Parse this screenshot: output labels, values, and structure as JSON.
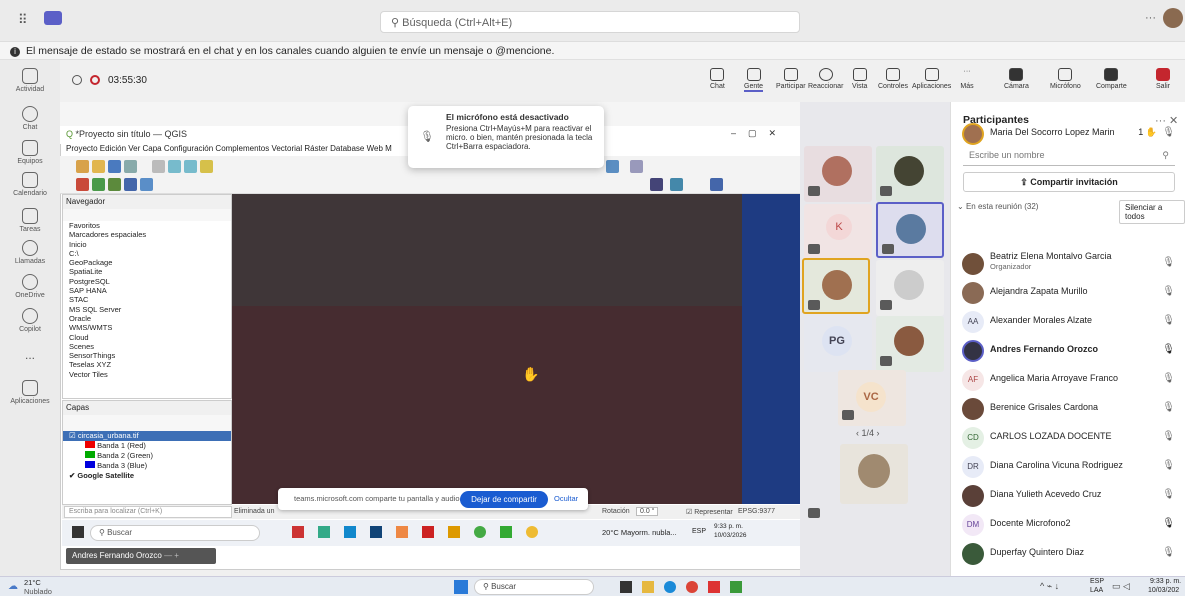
{
  "topbar": {
    "search_placeholder": "Búsqueda (Ctrl+Alt+E)",
    "more": "···"
  },
  "banner": {
    "text": "El mensaje de estado se mostrará en el chat y en los canales cuando alguien te envíe un mensaje o @mencione."
  },
  "rail": [
    {
      "label": "Actividad"
    },
    {
      "label": "Chat"
    },
    {
      "label": "Equipos"
    },
    {
      "label": "Calendario"
    },
    {
      "label": "Tareas"
    },
    {
      "label": "Llamadas"
    },
    {
      "label": "OneDrive"
    },
    {
      "label": "Copilot"
    },
    {
      "label": "..."
    },
    {
      "label": "Aplicaciones"
    }
  ],
  "meeting": {
    "timer": "03:55:30",
    "controls": [
      "Chat",
      "Gente",
      "Participar",
      "Reaccionar",
      "Vista",
      "Controles",
      "Aplicaciones",
      "Más",
      "Cámara",
      "Micrófono",
      "Comparte",
      "Salir"
    ]
  },
  "toast": {
    "title": "El micrófono está desactivado",
    "body": "Presiona Ctrl+Mayús+M para reactivar el micro. o bien, mantén presionada la tecla Ctrl+Barra espaciadora."
  },
  "qgis": {
    "title": "*Proyecto sin título — QGIS",
    "menu": "Proyecto  Edición  Ver  Capa  Configuración  Complementos  Vectorial  Ráster  Database  Web  M",
    "navigator_title": "Navegador",
    "navigator_items": [
      "Favoritos",
      "Marcadores espaciales",
      "Inicio",
      "C:\\",
      "GeoPackage",
      "SpatiaLite",
      "PostgreSQL",
      "SAP HANA",
      "STAC",
      "MS SQL Server",
      "Oracle",
      "WMS/WMTS",
      "Cloud",
      "Scenes",
      "SensorThings",
      "Teselas XYZ",
      "Vector Tiles"
    ],
    "layers_title": "Capas",
    "layers": [
      "circasia_urbana.tif",
      "Banda 1 (Red)",
      "Banda 2 (Green)",
      "Banda 3 (Blue)",
      "Google Satellite"
    ],
    "locate_placeholder": "Escriba para localizar (Ctrl+K)",
    "status_left": "Eliminada un",
    "rotation_label": "Rotación",
    "rotation": "0.0 °",
    "render": "Representar",
    "crs": "EPSG:9377"
  },
  "shared_taskbar": {
    "search": "Buscar",
    "weather": "20°C Mayorm. nubla...",
    "lang": "ESP",
    "time": "9:33 p. m.",
    "date": "10/03/2026"
  },
  "sharebar": {
    "text": "teams.microsoft.com comparte tu pantalla y audio.",
    "stop": "Dejar de compartir",
    "hide": "Ocultar"
  },
  "presenter": {
    "name": "Andres Fernando Orozco"
  },
  "gallery": {
    "tiles": [
      "K",
      "PG",
      "VC"
    ],
    "page": "1/4"
  },
  "participants": {
    "title": "Participantes",
    "search_placeholder": "Escribe un nombre",
    "share_invite": "Compartir invitación",
    "in_meeting": "En esta reunión (32)",
    "mute_all": "Silenciar a todos",
    "list": [
      {
        "name": "Maria Del Socorro Lopez Marin",
        "initials": "",
        "sub": "",
        "badge": "1"
      },
      {
        "name": "Beatriz Elena Montalvo Garcia",
        "initials": "",
        "sub": "Organizador",
        "badge": ""
      },
      {
        "name": "Alejandra Zapata Murillo",
        "initials": "",
        "sub": "",
        "badge": ""
      },
      {
        "name": "Alexander Morales Alzate",
        "initials": "AA",
        "sub": "",
        "badge": ""
      },
      {
        "name": "Andres Fernando Orozco",
        "initials": "",
        "sub": "",
        "badge": ""
      },
      {
        "name": "Angelica Maria Arroyave Franco",
        "initials": "AF",
        "sub": "",
        "badge": ""
      },
      {
        "name": "Berenice Grisales Cardona",
        "initials": "",
        "sub": "",
        "badge": ""
      },
      {
        "name": "CARLOS LOZADA DOCENTE",
        "initials": "CD",
        "sub": "",
        "badge": ""
      },
      {
        "name": "Diana Carolina Vicuna Rodriguez",
        "initials": "DR",
        "sub": "",
        "badge": ""
      },
      {
        "name": "Diana Yulieth Acevedo Cruz",
        "initials": "",
        "sub": "",
        "badge": ""
      },
      {
        "name": "Docente Microfono2",
        "initials": "DM",
        "sub": "",
        "badge": ""
      },
      {
        "name": "Duperfay Quintero Diaz",
        "initials": "",
        "sub": "",
        "badge": ""
      }
    ]
  },
  "taskbar": {
    "temp": "21°C",
    "weather": "Nublado",
    "search": "Buscar",
    "lang": "ESP",
    "lang2": "LAA",
    "time": "9:33 p. m.",
    "date": "10/03/202"
  }
}
